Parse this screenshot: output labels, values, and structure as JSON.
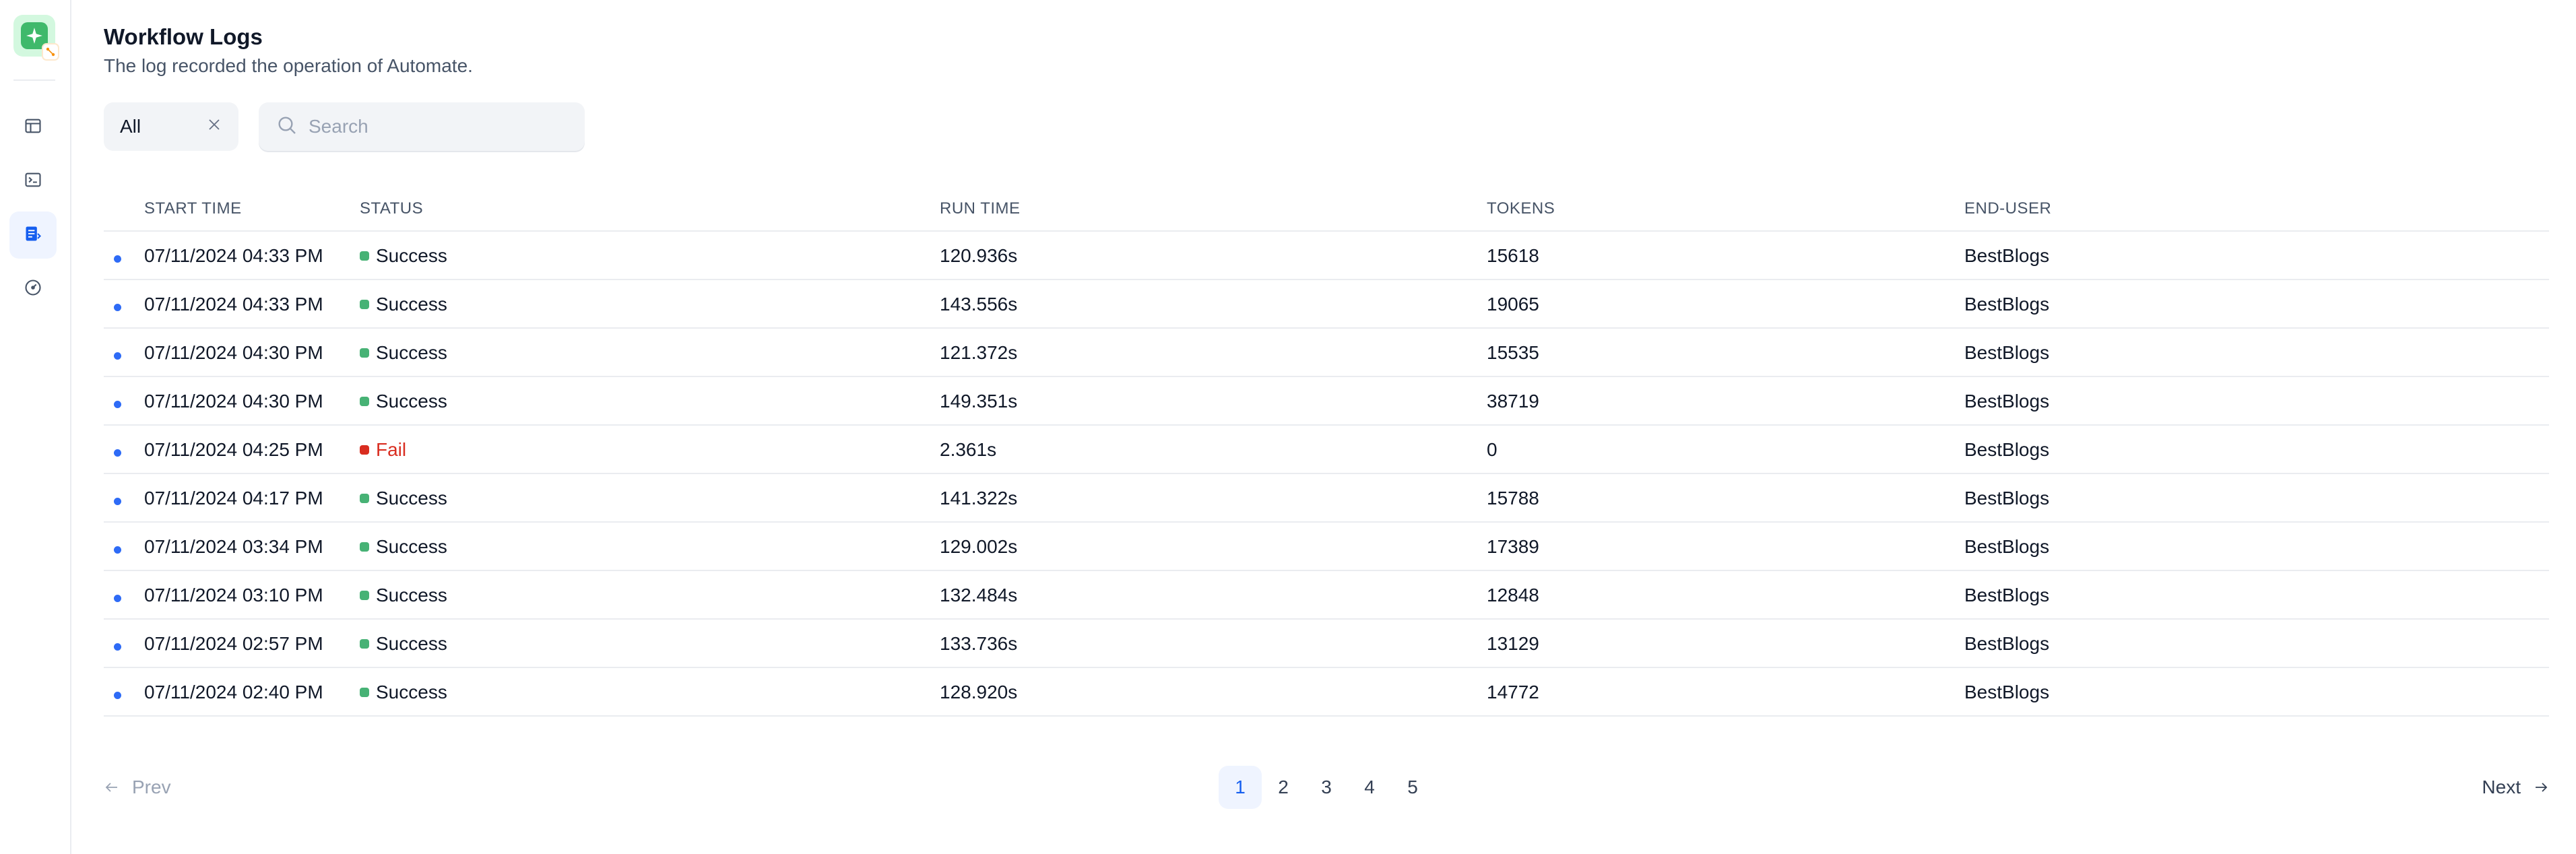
{
  "page": {
    "title": "Workflow Logs",
    "subtitle": "The log recorded the operation of Automate."
  },
  "sidebar": {
    "items": [
      {
        "name": "overview",
        "icon": "window-icon",
        "active": false
      },
      {
        "name": "api",
        "icon": "terminal-icon",
        "active": false
      },
      {
        "name": "logs",
        "icon": "document-icon",
        "active": true
      },
      {
        "name": "monitoring",
        "icon": "dashboard-gauge-icon",
        "active": false
      }
    ]
  },
  "filter": {
    "selected": "All"
  },
  "search": {
    "placeholder": "Search",
    "value": ""
  },
  "table": {
    "headers": {
      "start_time": "START TIME",
      "status": "STATUS",
      "run_time": "RUN TIME",
      "tokens": "TOKENS",
      "end_user": "END-USER"
    },
    "rows": [
      {
        "start_time": "07/11/2024 04:33 PM",
        "status": "Success",
        "run_time": "120.936s",
        "tokens": "15618",
        "end_user": "BestBlogs"
      },
      {
        "start_time": "07/11/2024 04:33 PM",
        "status": "Success",
        "run_time": "143.556s",
        "tokens": "19065",
        "end_user": "BestBlogs"
      },
      {
        "start_time": "07/11/2024 04:30 PM",
        "status": "Success",
        "run_time": "121.372s",
        "tokens": "15535",
        "end_user": "BestBlogs"
      },
      {
        "start_time": "07/11/2024 04:30 PM",
        "status": "Success",
        "run_time": "149.351s",
        "tokens": "38719",
        "end_user": "BestBlogs"
      },
      {
        "start_time": "07/11/2024 04:25 PM",
        "status": "Fail",
        "run_time": "2.361s",
        "tokens": "0",
        "end_user": "BestBlogs"
      },
      {
        "start_time": "07/11/2024 04:17 PM",
        "status": "Success",
        "run_time": "141.322s",
        "tokens": "15788",
        "end_user": "BestBlogs"
      },
      {
        "start_time": "07/11/2024 03:34 PM",
        "status": "Success",
        "run_time": "129.002s",
        "tokens": "17389",
        "end_user": "BestBlogs"
      },
      {
        "start_time": "07/11/2024 03:10 PM",
        "status": "Success",
        "run_time": "132.484s",
        "tokens": "12848",
        "end_user": "BestBlogs"
      },
      {
        "start_time": "07/11/2024 02:57 PM",
        "status": "Success",
        "run_time": "133.736s",
        "tokens": "13129",
        "end_user": "BestBlogs"
      },
      {
        "start_time": "07/11/2024 02:40 PM",
        "status": "Success",
        "run_time": "128.920s",
        "tokens": "14772",
        "end_user": "BestBlogs"
      }
    ]
  },
  "status_colors": {
    "Success": "#47b275",
    "Fail": "#d92d20",
    "unread_dot": "#2e6bf6"
  },
  "pagination": {
    "prev_label": "Prev",
    "next_label": "Next",
    "pages": [
      "1",
      "2",
      "3",
      "4",
      "5"
    ],
    "current": "1"
  }
}
